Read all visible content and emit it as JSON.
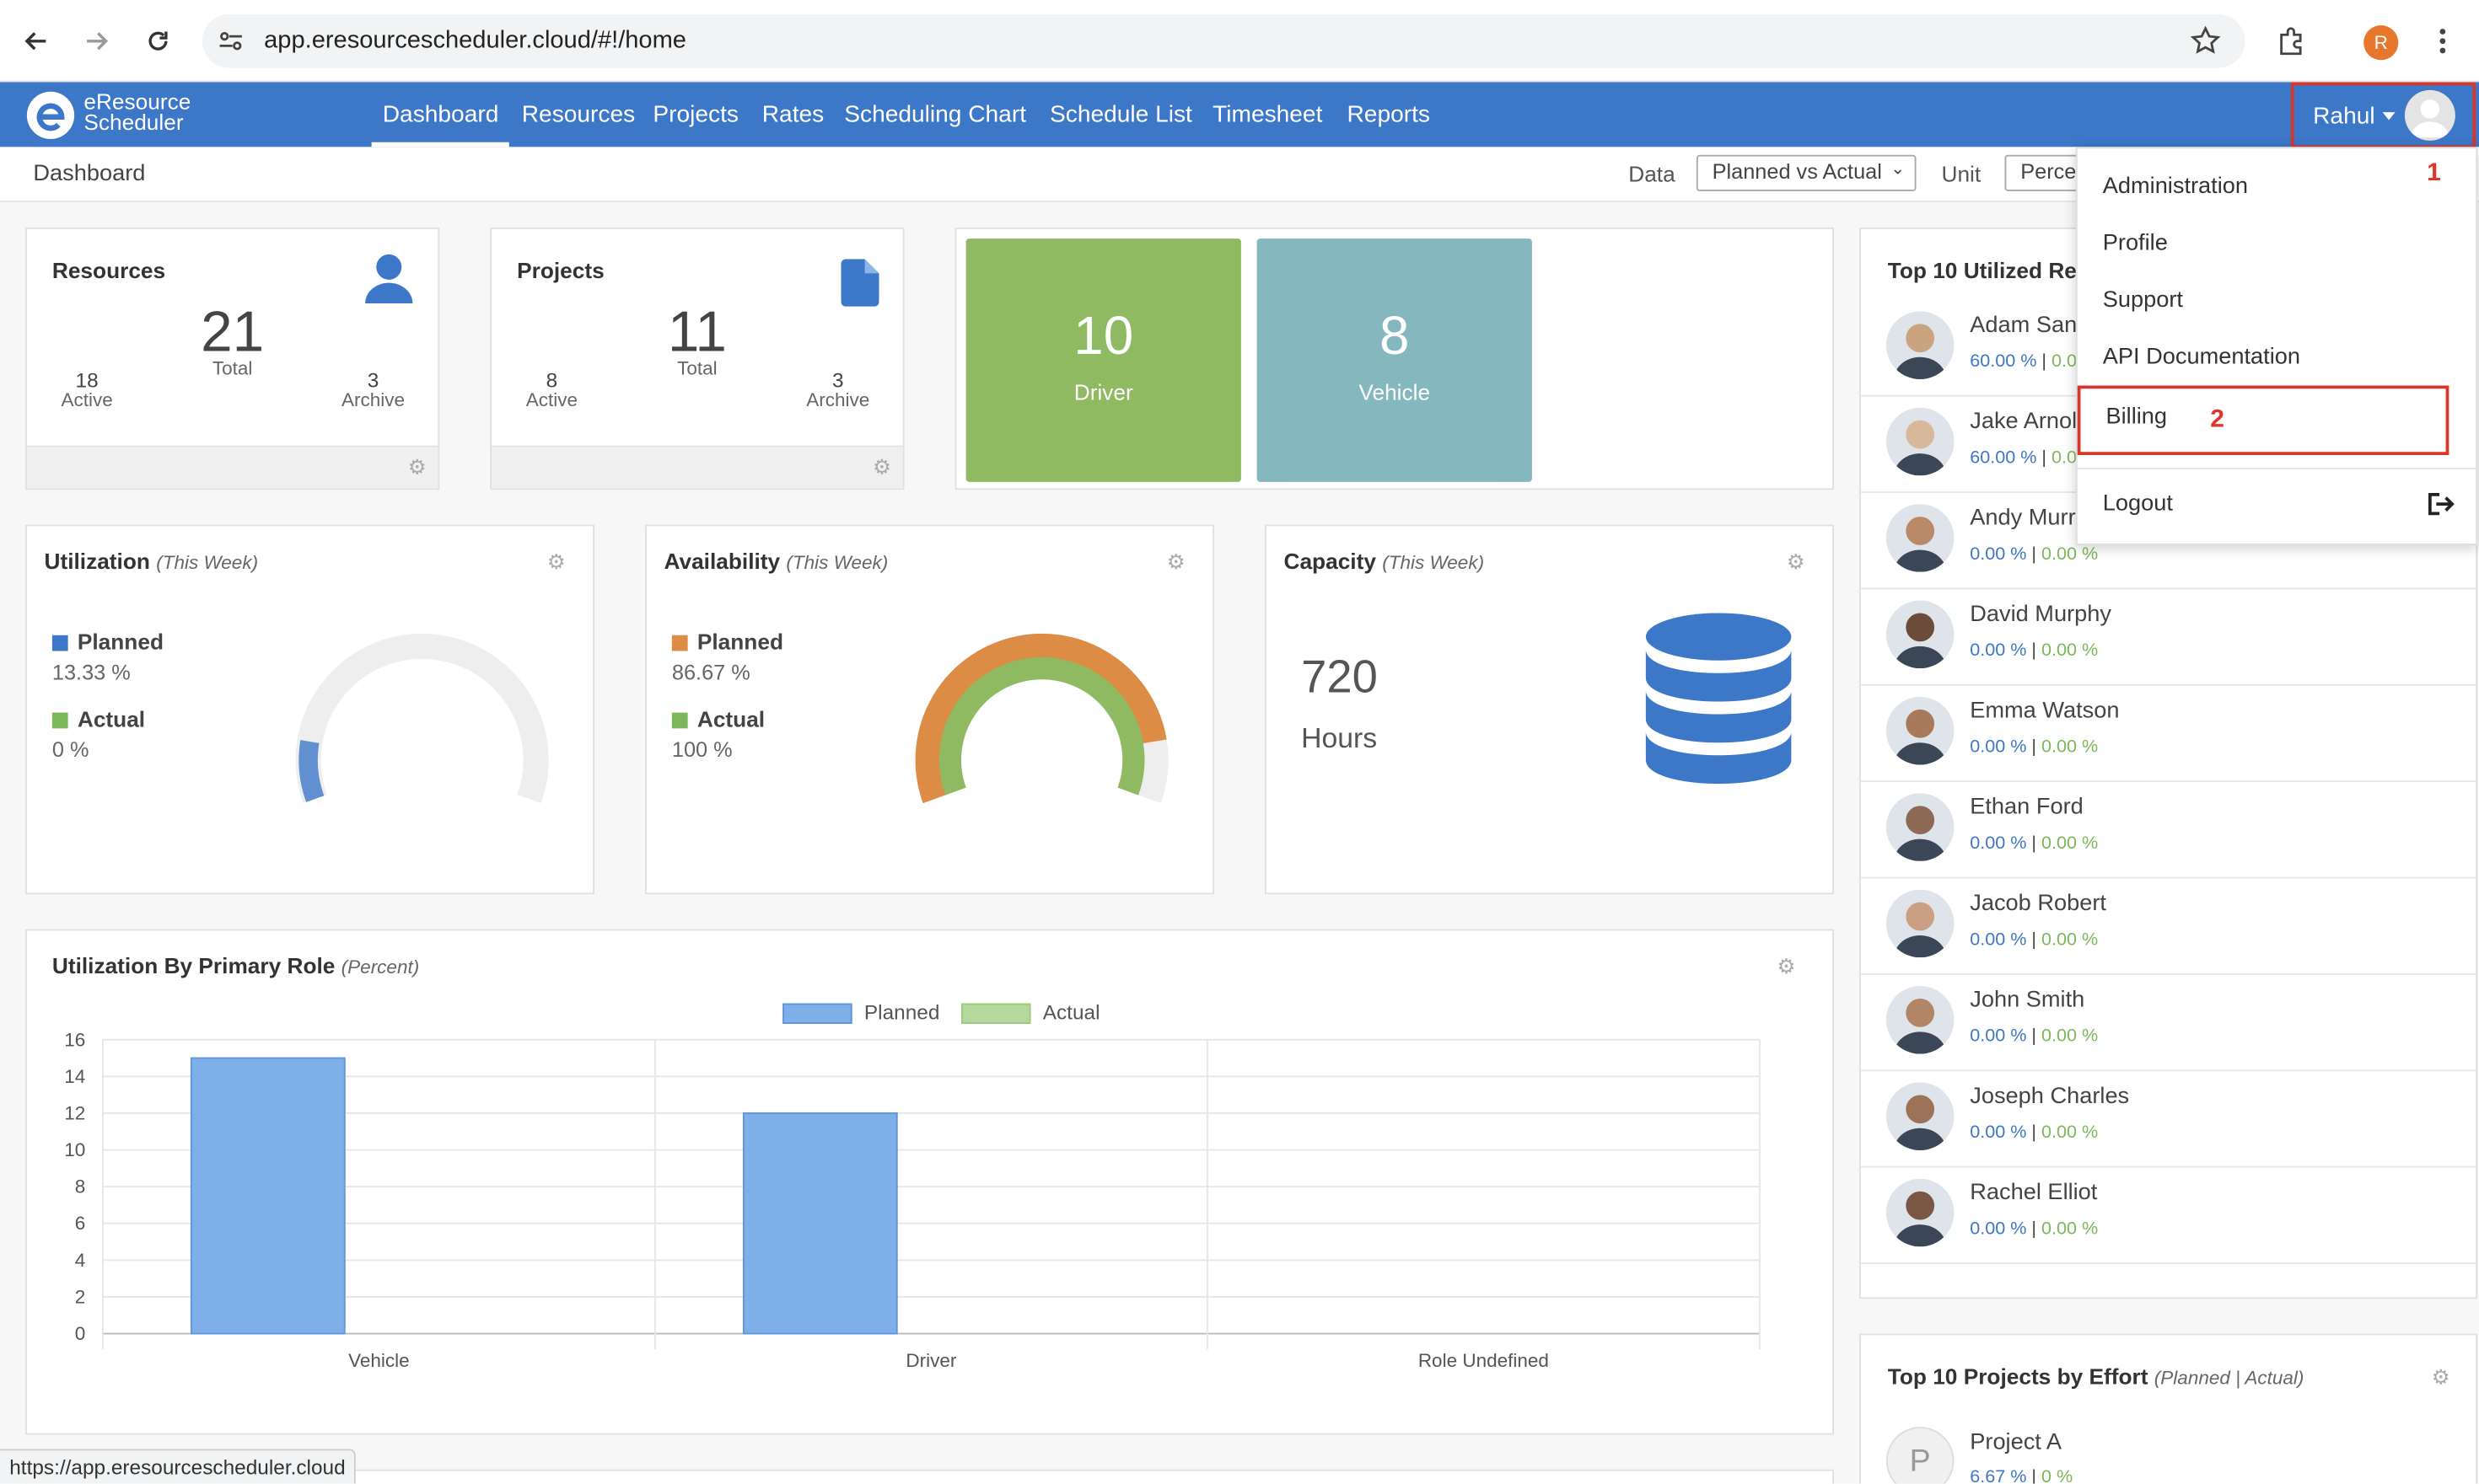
{
  "browser": {
    "url": "app.eresourcescheduler.cloud/#!/home",
    "profile_initial": "R",
    "status_url": "https://app.eresourcescheduler.cloud"
  },
  "app": {
    "logo_line1": "eResource",
    "logo_line2": "Scheduler",
    "nav": [
      "Dashboard",
      "Resources",
      "Projects",
      "Rates",
      "Scheduling Chart",
      "Schedule List",
      "Timesheet",
      "Reports"
    ],
    "active_nav": "Dashboard",
    "user_name": "Rahul",
    "accent_color": "#3d77c7"
  },
  "subbar": {
    "title": "Dashboard",
    "data_label": "Data",
    "data_value": "Planned vs Actual",
    "unit_label": "Unit",
    "unit_value": "Percen"
  },
  "user_dropdown": {
    "items": [
      "Administration",
      "Profile",
      "Support",
      "API Documentation",
      "Billing",
      "Logout"
    ],
    "annotation_1": "1",
    "annotation_2": "2"
  },
  "stats": {
    "resources": {
      "title": "Resources",
      "total": "21",
      "total_label": "Total",
      "active": "18",
      "active_label": "Active",
      "archive": "3",
      "archive_label": "Archive"
    },
    "projects": {
      "title": "Projects",
      "total": "11",
      "total_label": "Total",
      "active": "8",
      "active_label": "Active",
      "archive": "3",
      "archive_label": "Archive"
    }
  },
  "tiles": [
    {
      "value": "10",
      "label": "Driver",
      "color": "#8fba62"
    },
    {
      "value": "8",
      "label": "Vehicle",
      "color": "#84b8be"
    }
  ],
  "utilization": {
    "title": "Utilization",
    "period": "(This Week)",
    "planned_label": "Planned",
    "planned_value": "13.33 %",
    "planned_pct": 13.33,
    "actual_label": "Actual",
    "actual_value": "0 %",
    "actual_pct": 0
  },
  "availability": {
    "title": "Availability",
    "period": "(This Week)",
    "planned_label": "Planned",
    "planned_value": "86.67 %",
    "planned_pct": 86.67,
    "actual_label": "Actual",
    "actual_value": "100 %",
    "actual_pct": 100
  },
  "capacity": {
    "title": "Capacity",
    "period": "(This Week)",
    "value": "720",
    "unit": "Hours"
  },
  "role_chart": {
    "title": "Utilization By Primary Role",
    "subtitle": "(Percent)",
    "legend_planned": "Planned",
    "legend_actual": "Actual"
  },
  "chart_data": {
    "type": "bar",
    "categories": [
      "Vehicle",
      "Driver",
      "Role Undefined"
    ],
    "series": [
      {
        "name": "Planned",
        "values": [
          15,
          12,
          0
        ],
        "color": "#7fafe8"
      },
      {
        "name": "Actual",
        "values": [
          0,
          0,
          0
        ],
        "color": "#b5d99c"
      }
    ],
    "ylim": [
      0,
      16
    ],
    "yticks": [
      "0",
      "2",
      "4",
      "6",
      "8",
      "10",
      "12",
      "14",
      "16"
    ],
    "grid": true,
    "legend": "top-center"
  },
  "top_resources": {
    "title": "Top 10 Utilized Res",
    "rows": [
      {
        "name": "Adam Sand",
        "planned": "60.00 %",
        "sep": "|",
        "actual": "0.0"
      },
      {
        "name": "Jake Arnol",
        "planned": "60.00 %",
        "sep": "|",
        "actual": "0.0"
      },
      {
        "name": "Andy Murra",
        "planned": "0.00 %",
        "sep": "|",
        "actual": "0.00 %"
      },
      {
        "name": "David Murphy",
        "planned": "0.00 %",
        "sep": "|",
        "actual": "0.00 %"
      },
      {
        "name": "Emma Watson",
        "planned": "0.00 %",
        "sep": "|",
        "actual": "0.00 %"
      },
      {
        "name": "Ethan Ford",
        "planned": "0.00 %",
        "sep": "|",
        "actual": "0.00 %"
      },
      {
        "name": "Jacob Robert",
        "planned": "0.00 %",
        "sep": "|",
        "actual": "0.00 %"
      },
      {
        "name": "John Smith",
        "planned": "0.00 %",
        "sep": "|",
        "actual": "0.00 %"
      },
      {
        "name": "Joseph Charles",
        "planned": "0.00 %",
        "sep": "|",
        "actual": "0.00 %"
      },
      {
        "name": "Rachel Elliot",
        "planned": "0.00 %",
        "sep": "|",
        "actual": "0.00 %"
      }
    ]
  },
  "top_projects": {
    "title": "Top 10 Projects by Effort",
    "subtitle": "(Planned | Actual)",
    "rows": [
      {
        "initial": "P",
        "name": "Project A",
        "planned": "6.67 %",
        "sep": "|",
        "actual": "0 %"
      }
    ]
  }
}
